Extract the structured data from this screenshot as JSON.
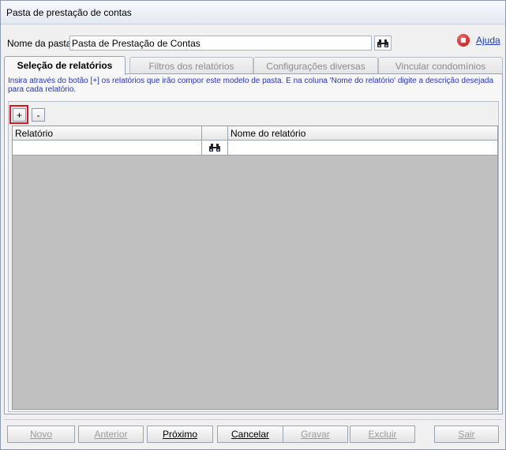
{
  "window": {
    "title": "Pasta de prestação de contas"
  },
  "header": {
    "name_label": "Nome da pasta:",
    "name_value": "Pasta de Prestação de Contas",
    "help_label": "Ajuda"
  },
  "tabs": [
    {
      "label": "Seleção de relatórios",
      "active": true
    },
    {
      "label": "Filtros dos relatórios",
      "active": false
    },
    {
      "label": "Configurações diversas",
      "active": false
    },
    {
      "label": "Vincular condomínios",
      "active": false
    }
  ],
  "panel": {
    "instruction": "Insira através do botão [+] os relatórios que irão compor este modelo de pasta. E na coluna 'Nome do relatório' digite a descrição desejada para cada relatório.",
    "add_label": "+",
    "remove_label": "-",
    "columns": {
      "report": "Relatório",
      "report_name": "Nome do relatório"
    }
  },
  "footer": {
    "buttons": [
      {
        "label": "Novo",
        "enabled": false
      },
      {
        "label": "Anterior",
        "enabled": false
      },
      {
        "label": "Próximo",
        "enabled": true
      },
      {
        "label": "Cancelar",
        "enabled": true
      },
      {
        "label": "Gravar",
        "enabled": false
      },
      {
        "label": "Excluir",
        "enabled": false
      },
      {
        "label": "Sair",
        "enabled": false
      }
    ]
  },
  "colors": {
    "instruction_text": "#2233cc",
    "highlight_border": "#e0121b",
    "grid_background": "#c0c0c0"
  },
  "icons": {
    "search": "binoculars-icon",
    "help": "help-record-icon"
  }
}
